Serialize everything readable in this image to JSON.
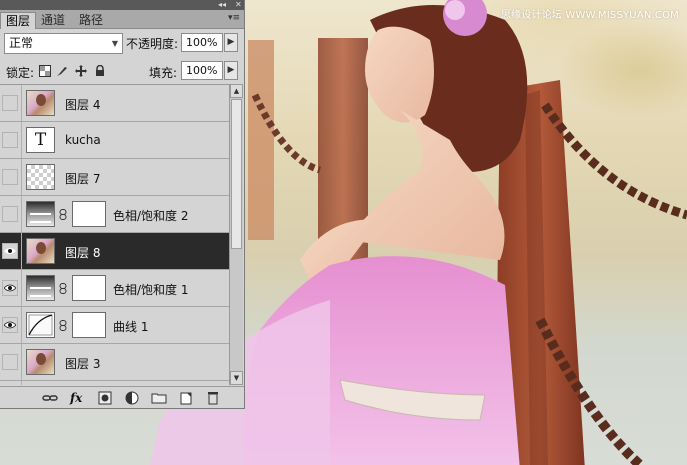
{
  "watermark": "思缘设计论坛 WWW.MISSYUAN.COM",
  "panel": {
    "tabs": [
      {
        "label": "图层",
        "active": true
      },
      {
        "label": "通道",
        "active": false
      },
      {
        "label": "路径",
        "active": false
      }
    ],
    "blend_mode": "正常",
    "opacity_label": "不透明度:",
    "opacity_value": "100%",
    "lock_label": "锁定:",
    "fill_label": "填充:",
    "fill_value": "100%",
    "layers": [
      {
        "name": "图层 4",
        "thumb": "photo",
        "visible": false,
        "mask": false,
        "selected": false
      },
      {
        "name": "kucha",
        "thumb": "text",
        "thumb_glyph": "T",
        "visible": false,
        "mask": false,
        "selected": false
      },
      {
        "name": "图层 7",
        "thumb": "checker",
        "visible": false,
        "mask": false,
        "selected": false
      },
      {
        "name": "色相/饱和度 2",
        "thumb": "adjustment",
        "visible": false,
        "mask": true,
        "selected": false
      },
      {
        "name": "图层 8",
        "thumb": "photo",
        "visible": true,
        "mask": false,
        "selected": true
      },
      {
        "name": "色相/饱和度 1",
        "thumb": "adjustment",
        "visible": true,
        "mask": true,
        "selected": false
      },
      {
        "name": "曲线 1",
        "thumb": "curves",
        "visible": true,
        "mask": true,
        "selected": false
      },
      {
        "name": "图层 3",
        "thumb": "photo",
        "visible": false,
        "mask": false,
        "selected": false
      }
    ],
    "bottom_icons": [
      "link-icon",
      "fx-icon",
      "add-mask-icon",
      "adjustment-layer-icon",
      "new-group-icon",
      "new-layer-icon",
      "delete-icon"
    ],
    "fx_label": "fx"
  }
}
